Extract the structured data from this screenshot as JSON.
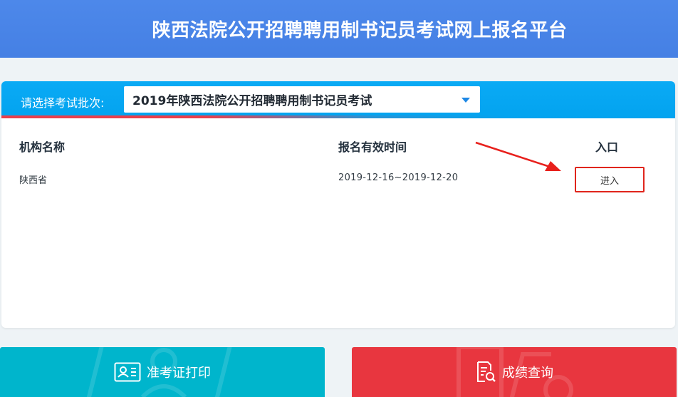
{
  "header": {
    "title": "陕西法院公开招聘聘用制书记员考试网上报名平台"
  },
  "batch": {
    "label": "请选择考试批次:",
    "selected": "2019年陕西法院公开招聘聘用制书记员考试"
  },
  "table": {
    "columns": [
      "机构名称",
      "报名有效时间",
      "入口"
    ],
    "rows": [
      {
        "org": "陕西省",
        "time": "2019-12-16~2019-12-20",
        "entry": "进入"
      }
    ]
  },
  "buttons": {
    "ticket_label": "准考证打印",
    "score_label": "成绩查询"
  },
  "colors": {
    "header": "#4a86e8",
    "panel_bar": "#03a9f4",
    "accent_red": "#e8363f",
    "ticket_button": "#00b5cc",
    "highlight_box": "#e0251c"
  },
  "icons": [
    "down-caret-icon",
    "id-card-icon",
    "document-search-icon",
    "annotation-arrow-icon"
  ]
}
